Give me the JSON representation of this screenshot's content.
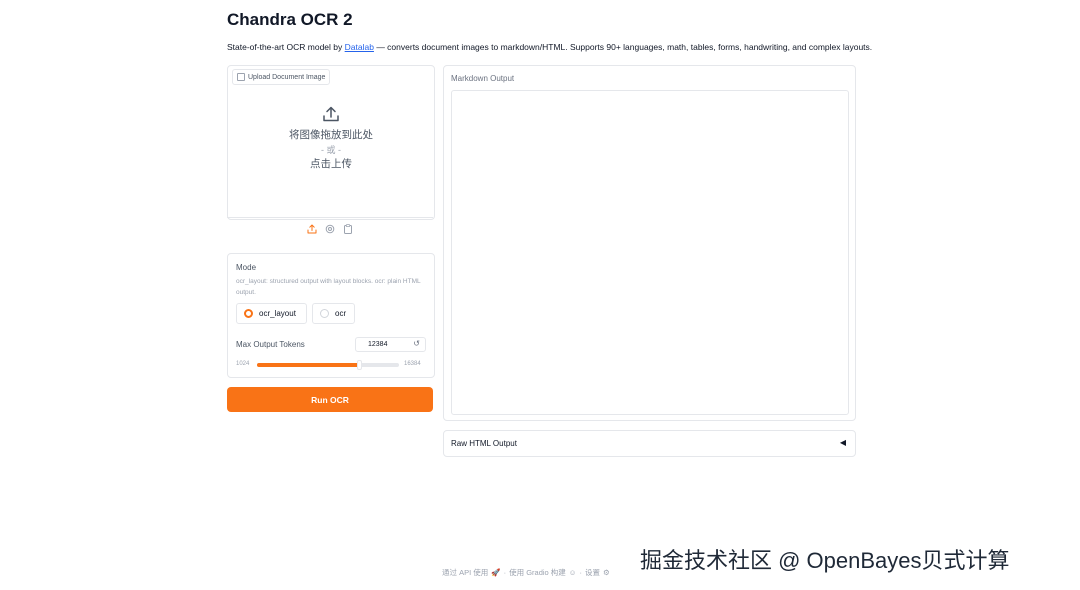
{
  "header": {
    "title": "Chandra OCR 2",
    "subtitle_pre": "State-of-the-art OCR model by ",
    "subtitle_link": "Datalab",
    "subtitle_post": " — converts document images to markdown/HTML. Supports 90+ languages, math, tables, forms, handwriting, and complex layouts."
  },
  "upload": {
    "tab_label": "Upload Document Image",
    "drop_line1": "将图像拖放到此处",
    "drop_line2": "- 或 -",
    "drop_line3": "点击上传",
    "source_icons": [
      "upload-icon",
      "webcam-icon",
      "clipboard-icon"
    ]
  },
  "mode": {
    "label": "Mode",
    "info": "ocr_layout: structured output with layout blocks. ocr: plain HTML output.",
    "options": [
      "ocr_layout",
      "ocr"
    ],
    "selected": "ocr_layout"
  },
  "tokens": {
    "label": "Max Output Tokens",
    "value": "12384",
    "min": "1024",
    "max": "16384",
    "fraction": 0.72
  },
  "run_button": "Run OCR",
  "markdown": {
    "label": "Markdown Output"
  },
  "raw_html": {
    "label": "Raw HTML Output",
    "toggle": "◀"
  },
  "footer": {
    "api": "通过 API 使用",
    "sep1": "·",
    "gradio": "使用 Gradio 构建",
    "sep2": "·",
    "settings": "设置"
  },
  "watermark": "掘金技术社区 @ OpenBayes贝式计算",
  "colors": {
    "accent": "#f97316",
    "link": "#2563eb",
    "border": "#e5e7eb"
  }
}
